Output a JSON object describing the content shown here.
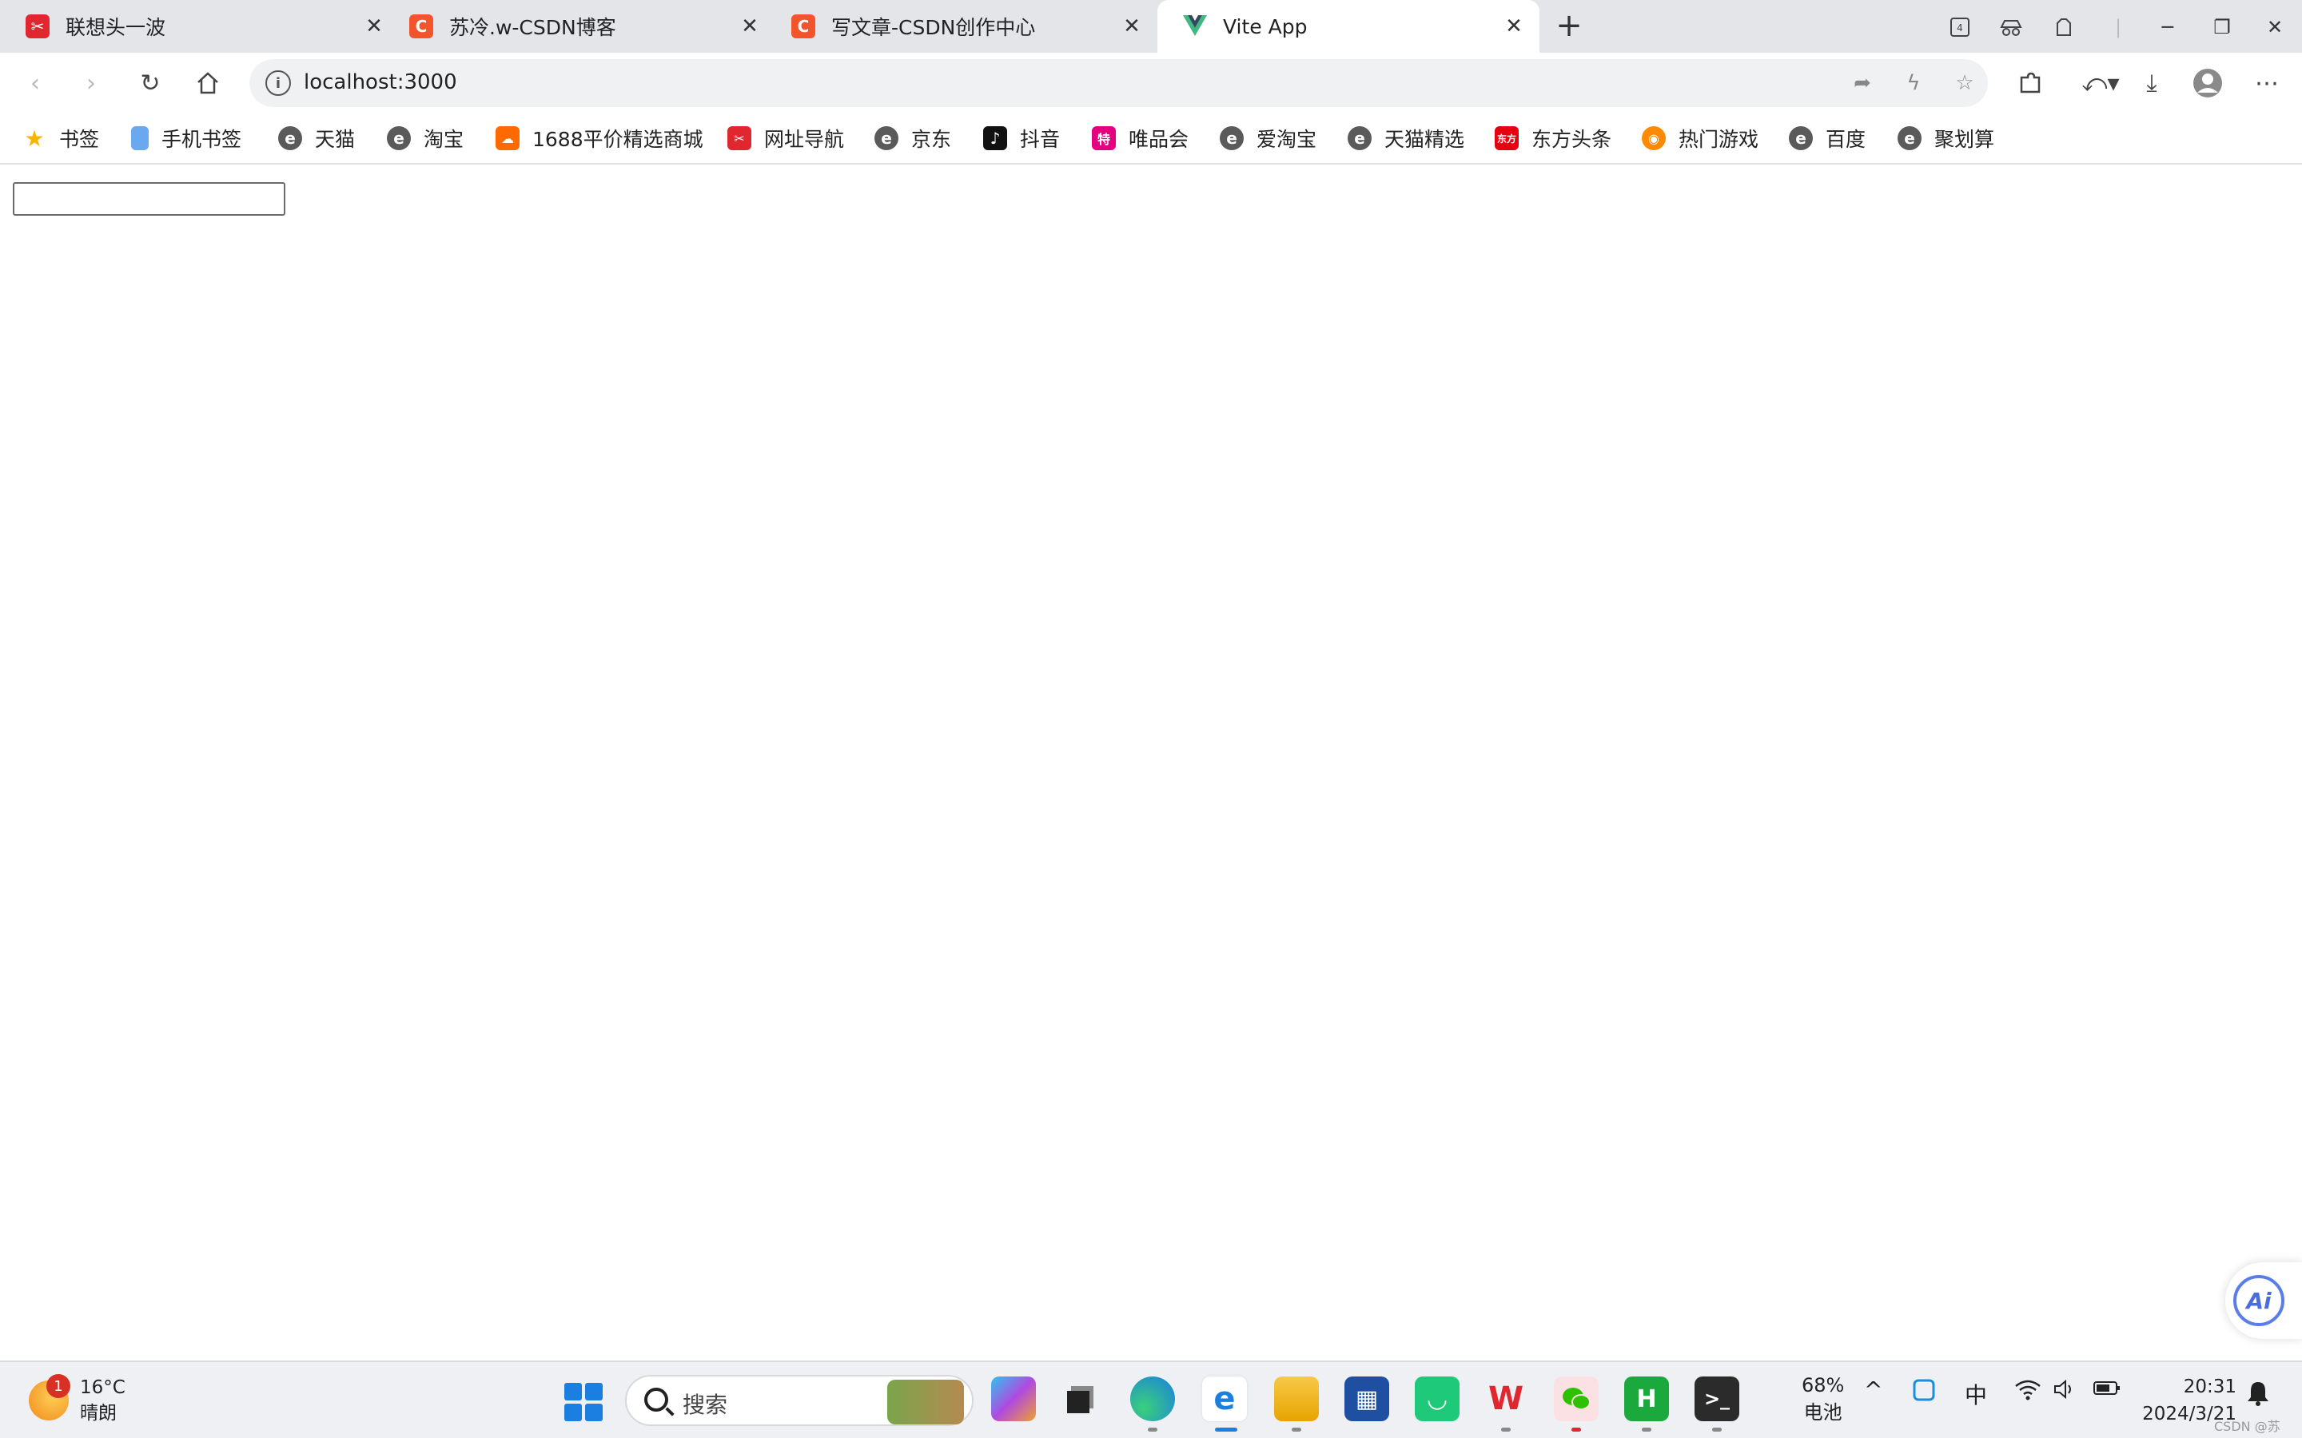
{
  "tabs": [
    {
      "title": "联想头一波",
      "icon": "lenovo-icon",
      "color": "#e0262f"
    },
    {
      "title": "苏冷.w-CSDN博客",
      "icon": "csdn-icon",
      "color": "#f2552c"
    },
    {
      "title": "写文章-CSDN创作中心",
      "icon": "csdn-icon",
      "color": "#f2552c"
    },
    {
      "title": "Vite App",
      "icon": "vue-icon",
      "color": "#41b883"
    }
  ],
  "window": {
    "workspaces_count": "4"
  },
  "address": {
    "url": "localhost:3000"
  },
  "bookmarks": [
    {
      "label": "书签"
    },
    {
      "label": "手机书签"
    },
    {
      "label": "天猫"
    },
    {
      "label": "淘宝"
    },
    {
      "label": "1688平价精选商城"
    },
    {
      "label": "网址导航"
    },
    {
      "label": "京东"
    },
    {
      "label": "抖音"
    },
    {
      "label": "唯品会"
    },
    {
      "label": "爱淘宝"
    },
    {
      "label": "天猫精选"
    },
    {
      "label": "东方头条"
    },
    {
      "label": "热门游戏"
    },
    {
      "label": "百度"
    },
    {
      "label": "聚划算"
    }
  ],
  "page": {
    "input_value": ""
  },
  "ai_button": {
    "label": "Ai"
  },
  "taskbar": {
    "weather_temp": "16°C",
    "weather_desc": "晴朗",
    "weather_badge": "1",
    "search_placeholder": "搜索",
    "battery_percent": "68%",
    "battery_label": "电池",
    "ime": "中",
    "time": "20:31",
    "date": "2024/3/21"
  },
  "watermark": "CSDN @苏冷.w"
}
